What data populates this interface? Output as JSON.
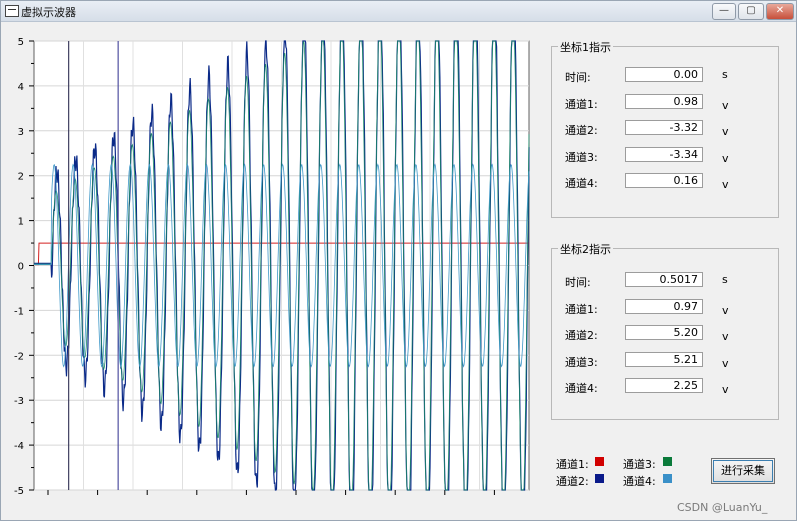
{
  "window": {
    "title": "虚拟示波器",
    "min_glyph": "—",
    "max_glyph": "▢",
    "close_glyph": "✕"
  },
  "chart_data": {
    "type": "line",
    "xlabel": "",
    "ylabel": "",
    "ylim": [
      -5,
      5
    ],
    "y_ticks": [
      "5",
      "4",
      "3",
      "2",
      "1",
      "0",
      "-1",
      "-2",
      "-3",
      "-4",
      "-5"
    ],
    "x_range_s": [
      0,
      1
    ],
    "grid": true,
    "cursors_s": [
      0.07,
      0.17
    ],
    "series": [
      {
        "color": "#d42020",
        "description": "step from 0 to about 0.5 V at about 0.01 s",
        "amplitude": 0.5
      },
      {
        "color": "#0b2a88",
        "kind": "growing sine, clipped at ±5 V",
        "amplitude_end": 5.2
      },
      {
        "color": "#1e8a6a",
        "kind": "growing sine, clipped at ±5 V",
        "amplitude_end": 5.21
      },
      {
        "color": "#3f98c8",
        "kind": "sine",
        "amplitude": 2.25
      }
    ]
  },
  "cursor1": {
    "title": "坐标1指示",
    "rows": [
      {
        "label": "时间:",
        "value": "0.00",
        "unit": "s"
      },
      {
        "label": "通道1:",
        "value": "0.98",
        "unit": "v"
      },
      {
        "label": "通道2:",
        "value": "-3.32",
        "unit": "v"
      },
      {
        "label": "通道3:",
        "value": "-3.34",
        "unit": "v"
      },
      {
        "label": "通道4:",
        "value": "0.16",
        "unit": "v"
      }
    ]
  },
  "cursor2": {
    "title": "坐标2指示",
    "rows": [
      {
        "label": "时间:",
        "value": "0.5017",
        "unit": "s"
      },
      {
        "label": "通道1:",
        "value": "0.97",
        "unit": "v"
      },
      {
        "label": "通道2:",
        "value": "5.20",
        "unit": "v"
      },
      {
        "label": "通道3:",
        "value": "5.21",
        "unit": "v"
      },
      {
        "label": "通道4:",
        "value": "2.25",
        "unit": "v"
      }
    ]
  },
  "legend": [
    {
      "label": "通道1:",
      "color": "#d10000"
    },
    {
      "label": "通道3:",
      "color": "#0a7a3a"
    },
    {
      "label": "通道2:",
      "color": "#0a1a8a"
    },
    {
      "label": "通道4:",
      "color": "#3a90c8"
    }
  ],
  "collect_button": "进行采集",
  "watermark": "CSDN @LuanYu_"
}
